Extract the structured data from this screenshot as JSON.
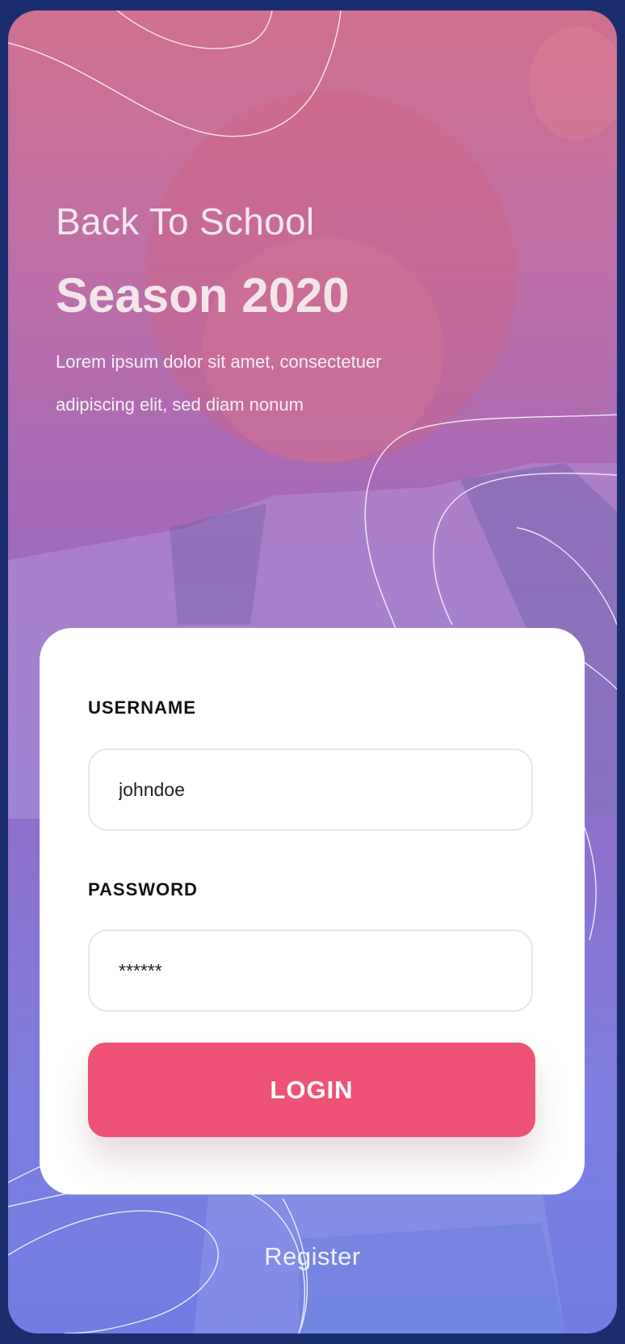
{
  "hero": {
    "subtitle": "Back To School",
    "title": "Season 2020",
    "body": "Lorem ipsum dolor sit amet, consectetuer adipiscing elit, sed diam nonum"
  },
  "form": {
    "username_label": "USERNAME",
    "username_value": "johndoe",
    "password_label": "PASSWORD",
    "password_value": "******",
    "login_label": "LOGIN"
  },
  "footer": {
    "register_label": "Register"
  },
  "colors": {
    "accent": "#ee5276",
    "frame_border": "#1a2e6e"
  }
}
